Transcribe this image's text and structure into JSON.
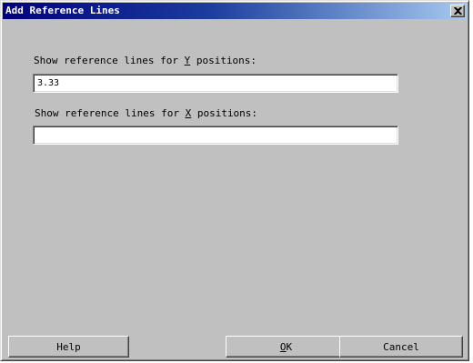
{
  "dialog": {
    "title": "Add Reference Lines"
  },
  "y_field": {
    "label_before": "Show reference lines for ",
    "label_mnemonic": "Y",
    "label_after": " positions:",
    "value": "3.33"
  },
  "x_field": {
    "label_before": "Show reference lines for ",
    "label_mnemonic": "X",
    "label_after": " positions:",
    "value": ""
  },
  "buttons": {
    "help": "Help",
    "ok_mnemonic": "O",
    "ok_rest": "K",
    "cancel": "Cancel"
  },
  "icons": {
    "close": "close-icon"
  },
  "colors": {
    "titlebar_start": "#000080",
    "titlebar_end": "#a6caf0",
    "dialog_face": "#c0c0c0"
  }
}
